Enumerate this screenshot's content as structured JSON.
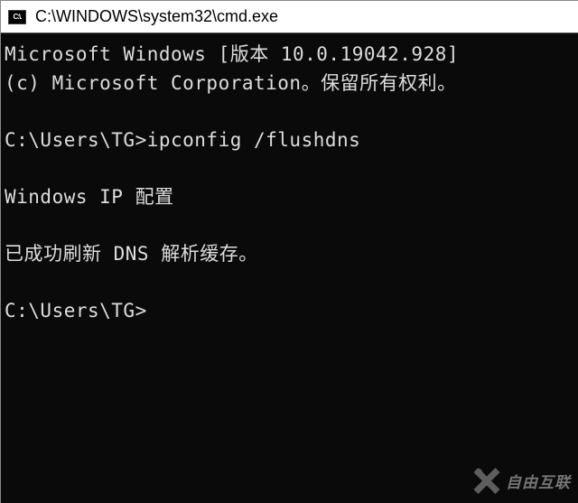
{
  "window": {
    "title": "C:\\WINDOWS\\system32\\cmd.exe",
    "icon_label": "C:\\."
  },
  "terminal": {
    "line1": "Microsoft Windows [版本 10.0.19042.928]",
    "line2": "(c) Microsoft Corporation。保留所有权利。",
    "prompt1": "C:\\Users\\TG>",
    "command1": "ipconfig /flushdns",
    "section_header": "Windows IP 配置",
    "result": "已成功刷新 DNS 解析缓存。",
    "prompt2": "C:\\Users\\TG>"
  },
  "watermark": {
    "text": "自由互联"
  }
}
